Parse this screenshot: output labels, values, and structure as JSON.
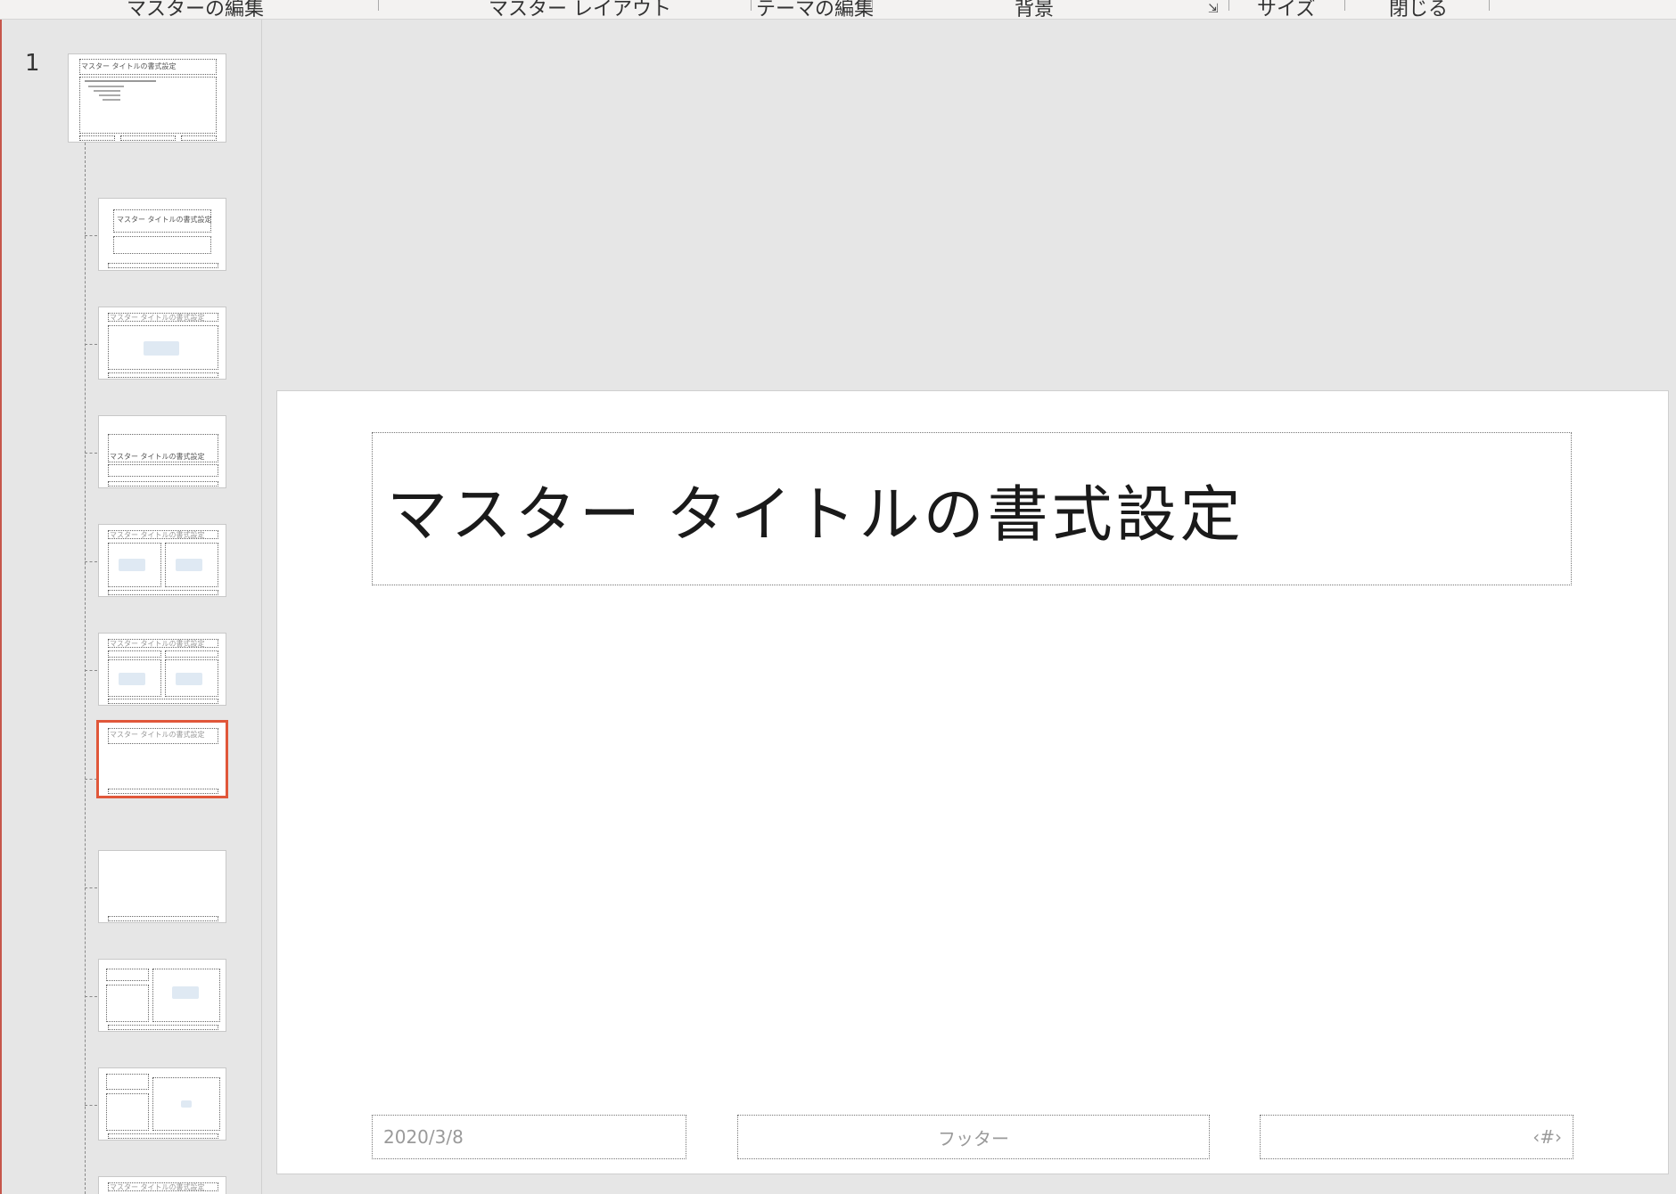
{
  "ribbon": {
    "groups": [
      {
        "label": "マスターの編集"
      },
      {
        "label": "マスター レイアウト"
      },
      {
        "label": "テーマの編集"
      },
      {
        "label": "背景"
      },
      {
        "label": "サイズ"
      },
      {
        "label": "閉じる"
      }
    ]
  },
  "thumbnail_pane": {
    "slide_number": "1",
    "master_title": "マスター タイトルの書式設定",
    "selected_layout_index": 7
  },
  "slide": {
    "title": "マスター タイトルの書式設定",
    "date": "2020/3/8",
    "footer": "フッター",
    "page_number": "‹#›"
  },
  "colors": {
    "selection": "#e0573a",
    "pane_bg": "#e6e6e6"
  }
}
